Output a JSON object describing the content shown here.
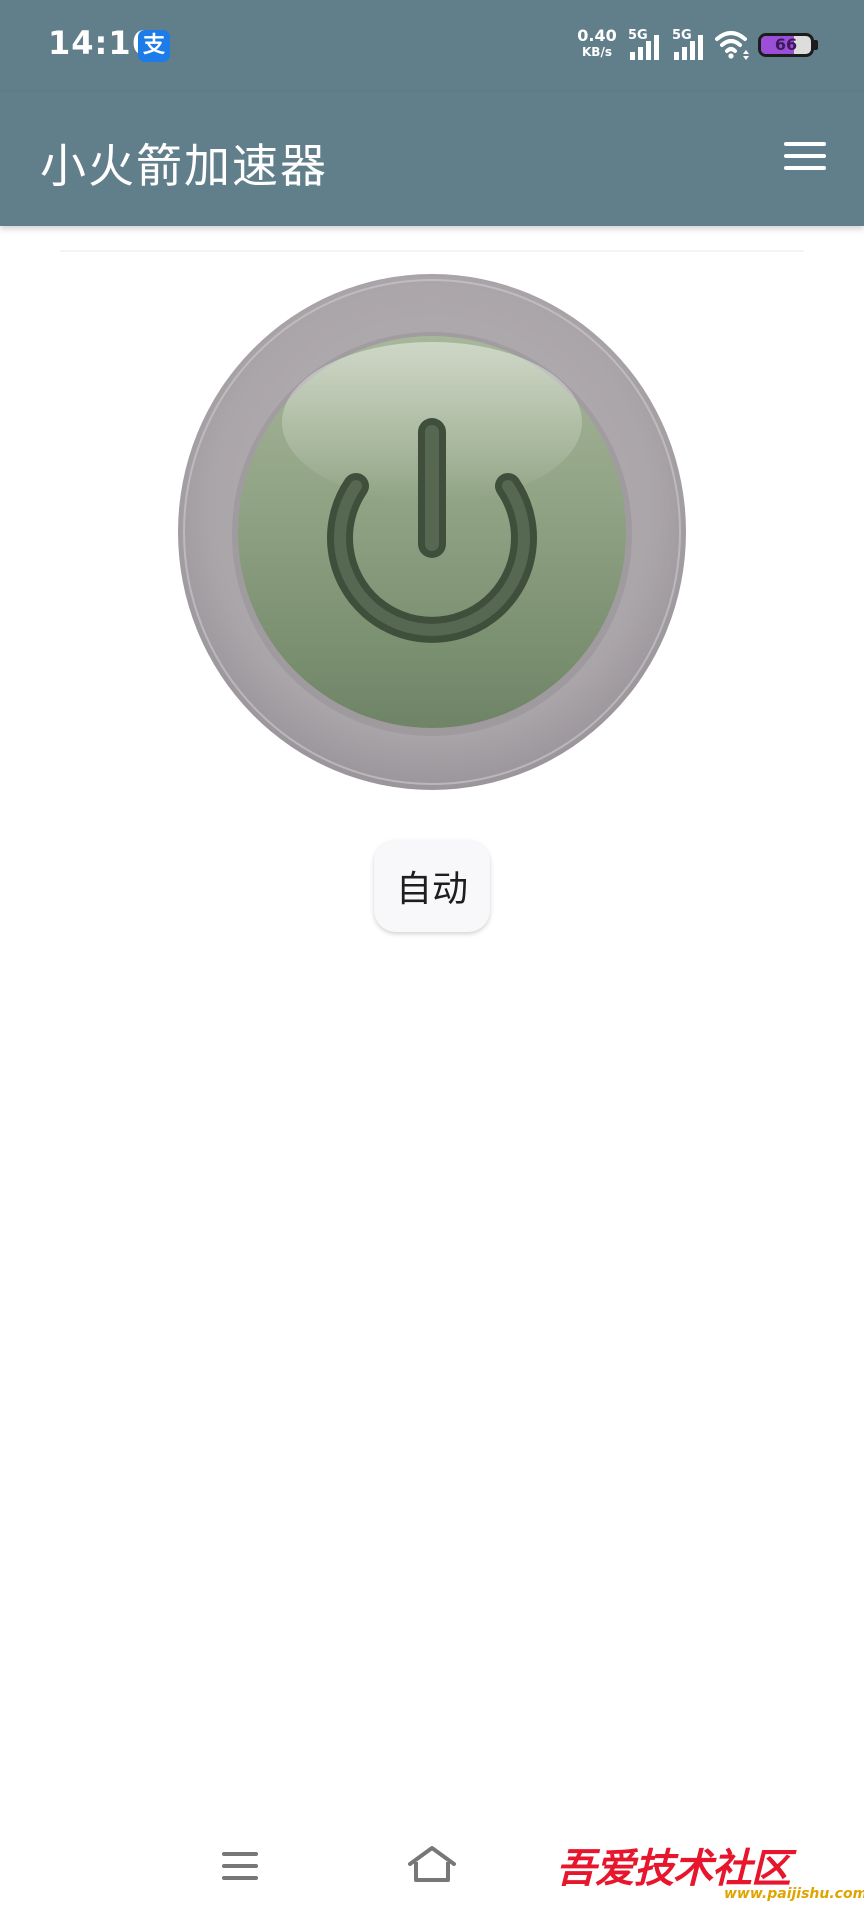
{
  "status_bar": {
    "time": "14:16",
    "alipay_icon": "alipay-icon",
    "alipay_glyph": "支",
    "net_speed_value": "0.40",
    "net_speed_unit": "KB/s",
    "signal_1_label": "5G",
    "signal_2_label": "5G",
    "battery_level": "66",
    "battery_fraction": 0.66,
    "battery_color": "#9b4fd8"
  },
  "app_bar": {
    "title": "小火箭加速器",
    "background_color": "#617e8b",
    "menu_icon": "hamburger-menu-icon"
  },
  "main": {
    "power_button_icon": "power-icon",
    "power_button_color": "#8fa283",
    "mode_button_label": "自动"
  },
  "nav_bar": {
    "menu_icon": "nav-menu-icon",
    "home_icon": "nav-home-icon"
  },
  "watermark": {
    "logo_text": "吾爱技术社区",
    "url": "www.paijishu.com"
  }
}
